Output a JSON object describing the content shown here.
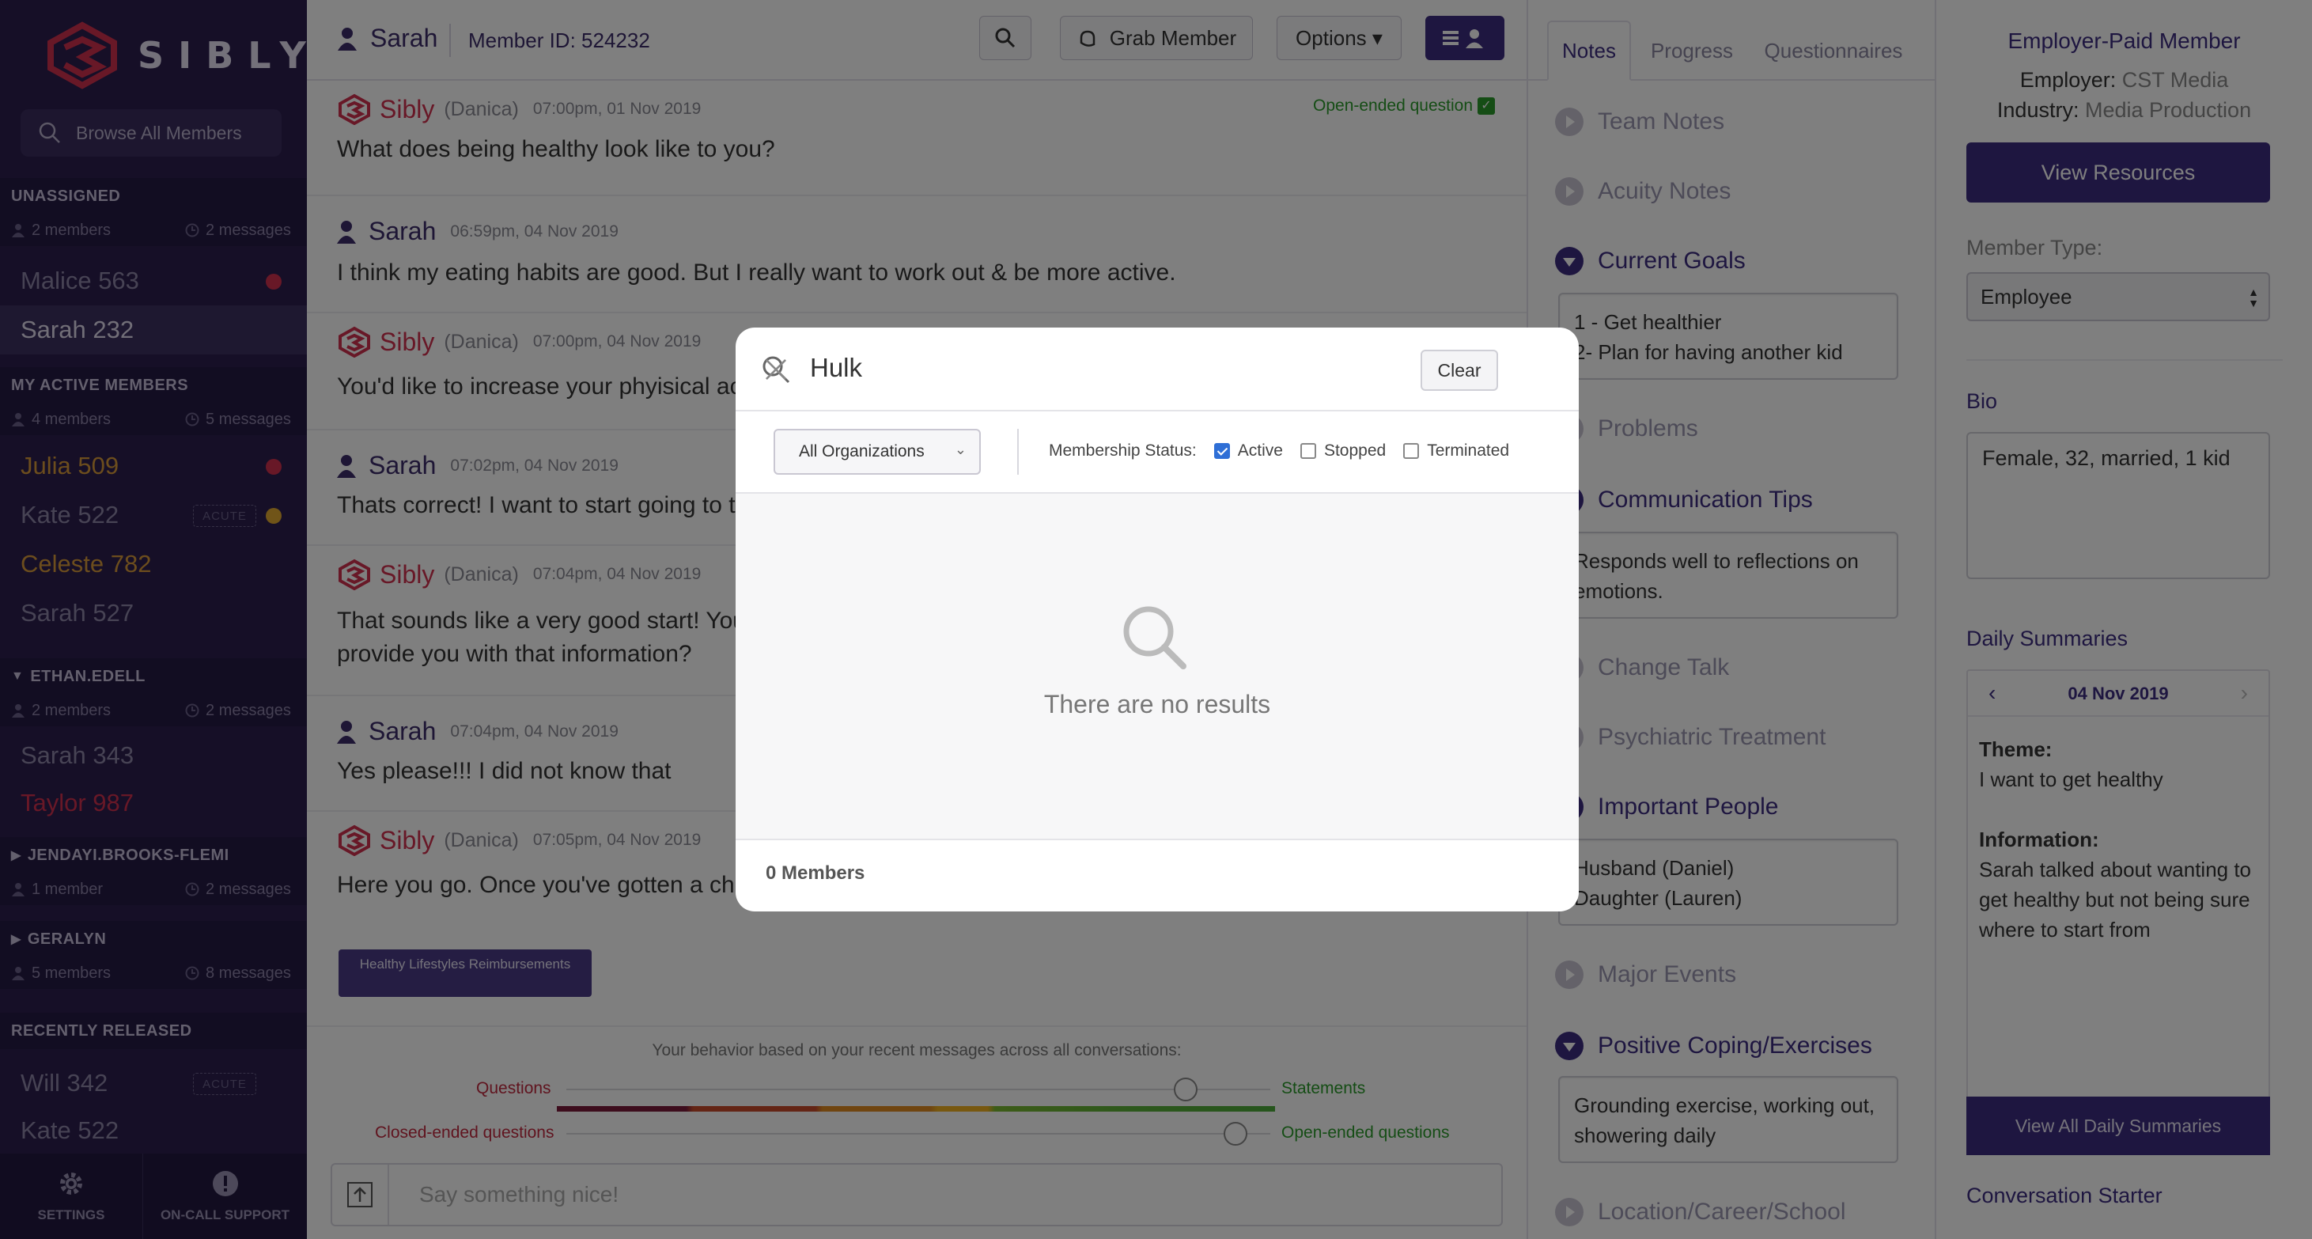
{
  "sidebar": {
    "brand": "SIBLY",
    "browse": "Browse All Members",
    "sections": [
      {
        "title": "UNASSIGNED",
        "members_count": "2 members",
        "messages_count": "2 messages",
        "members": [
          {
            "name": "Malice 563"
          },
          {
            "name": "Sarah 232"
          }
        ]
      },
      {
        "title": "MY ACTIVE MEMBERS",
        "members_count": "4 members",
        "messages_count": "5 messages",
        "members": [
          {
            "name": "Julia 509"
          },
          {
            "name": "Kate 522",
            "badge": "ACUTE"
          },
          {
            "name": "Celeste 782"
          },
          {
            "name": "Sarah 527"
          }
        ]
      },
      {
        "title": "ETHAN.EDELL",
        "members_count": "2 members",
        "messages_count": "2 messages",
        "members": [
          {
            "name": "Sarah 343"
          },
          {
            "name": "Taylor 987"
          }
        ]
      },
      {
        "title": "JENDAYI.BROOKS-FLEMI",
        "members_count": "1 member",
        "messages_count": "2 messages"
      },
      {
        "title": "GERALYN",
        "members_count": "5 members",
        "messages_count": "8 messages"
      },
      {
        "title": "RECENTLY RELEASED",
        "members": [
          {
            "name": "Will 342",
            "badge": "ACUTE"
          },
          {
            "name": "Kate 522"
          }
        ]
      }
    ],
    "settings": "SETTINGS",
    "oncall": "ON-CALL SUPPORT"
  },
  "topbar": {
    "member_name": "Sarah",
    "member_id": "Member ID: 524232",
    "grab": "Grab Member",
    "options": "Options ▾"
  },
  "messages": [
    {
      "who": "Sibly",
      "sub": "(Danica)",
      "ts": "07:00pm, 01 Nov 2019",
      "body": "What does being healthy look like to you?",
      "tag": "Open-ended question"
    },
    {
      "who": "Sarah",
      "ts": "06:59pm, 04 Nov 2019",
      "body": "I think my eating habits are good. But I really want to work out & be more active."
    },
    {
      "who": "Sibly",
      "sub": "(Danica)",
      "ts": "07:00pm, 04 Nov 2019",
      "body": "You'd like to increase your phyisical activity level, is that right?"
    },
    {
      "who": "Sarah",
      "ts": "07:02pm, 04 Nov 2019",
      "body": "Thats correct! I want to start going to the gym"
    },
    {
      "who": "Sibly",
      "sub": "(Danica)",
      "ts": "07:04pm, 04 Nov 2019",
      "body": "That sounds like a very good start! Your employer offers gym reimbursements, would you like for me to provide you with that information?"
    },
    {
      "who": "Sarah",
      "ts": "07:04pm, 04 Nov 2019",
      "body": "Yes please!!! I did not know that"
    },
    {
      "who": "Sibly",
      "sub": "(Danica)",
      "ts": "07:05pm, 04 Nov 2019",
      "body": "Here you go. Once you've gotten a chance to look at it, let me know! How does this sound to you?",
      "chip": "Healthy Lifestyles Reimbursements"
    }
  ],
  "behavior": {
    "caption": "Your behavior based on your recent messages across all conversations:",
    "left1": "Questions",
    "right1": "Statements",
    "value1": 0.88,
    "left2": "Closed-ended questions",
    "right2": "Open-ended questions",
    "value2": 0.95
  },
  "composer": {
    "placeholder": "Say something nice!"
  },
  "notes": {
    "tabs": [
      "Notes",
      "Progress",
      "Questionnaires"
    ],
    "sections": [
      {
        "title": "Team Notes",
        "open": false
      },
      {
        "title": "Acuity Notes",
        "open": false
      },
      {
        "title": "Current Goals",
        "open": true,
        "text": "1 - Get healthier\n2- Plan for having another kid"
      },
      {
        "title": "Problems",
        "open": false
      },
      {
        "title": "Communication Tips",
        "open": true,
        "text": "Responds well to reflections on emotions."
      },
      {
        "title": "Change Talk",
        "open": false
      },
      {
        "title": "Psychiatric Treatment",
        "open": false
      },
      {
        "title": "Important People",
        "open": true,
        "text": "Husband (Daniel)\nDaughter (Lauren)"
      },
      {
        "title": "Major Events",
        "open": false
      },
      {
        "title": "Positive Coping/Exercises",
        "open": true,
        "text": "Grounding exercise, working out, showering daily"
      },
      {
        "title": "Location/Career/School",
        "open": false
      }
    ]
  },
  "info": {
    "heading": "Employer-Paid Member",
    "employer_label": "Employer:",
    "employer": "CST Media",
    "industry_label": "Industry:",
    "industry": "Media Production",
    "view_resources": "View Resources",
    "member_type_label": "Member Type:",
    "member_type": "Employee",
    "bio_label": "Bio",
    "bio": "Female, 32, married, 1 kid",
    "daily_label": "Daily Summaries",
    "daily_date": "04 Nov 2019",
    "theme_label": "Theme:",
    "theme": "I want to get healthy",
    "information_label": "Information:",
    "information": "Sarah talked about wanting to get healthy but not being sure where to start from",
    "view_all": "View All Daily Summaries",
    "conv_starter": "Conversation Starter"
  },
  "modal": {
    "query": "Hulk",
    "clear": "Clear",
    "org": "All Organizations",
    "status_label": "Membership Status:",
    "statuses": [
      {
        "label": "Active",
        "checked": true
      },
      {
        "label": "Stopped",
        "checked": false
      },
      {
        "label": "Terminated",
        "checked": false
      }
    ],
    "no_results": "There are no results",
    "count": "0 Members"
  },
  "colors": {
    "brand_purple": "#3d2c80",
    "sibly_red": "#d0304e",
    "sidebar": "#2c1f4f"
  }
}
